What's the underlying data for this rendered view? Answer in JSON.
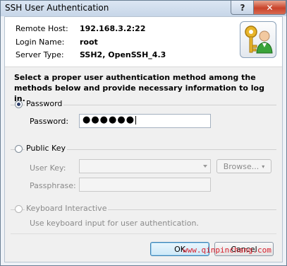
{
  "window": {
    "title": "SSH User Authentication",
    "help_label": "?",
    "close_label": "✕"
  },
  "info": {
    "remote_host_label": "Remote Host:",
    "remote_host_value": "192.168.3.2:22",
    "login_name_label": "Login Name:",
    "login_name_value": "root",
    "server_type_label": "Server Type:",
    "server_type_value": "SSH2, OpenSSH_4.3"
  },
  "instructions": "Select a proper user authentication method among the methods below and provide necessary information to log in.",
  "password_method": {
    "label": "Password",
    "selected": true,
    "field_label": "Password:",
    "masked_value": "●●●●●●"
  },
  "public_key_method": {
    "label": "Public Key",
    "selected": false,
    "user_key_label": "User Key:",
    "browse_label": "Browse...",
    "passphrase_label": "Passphrase:"
  },
  "keyboard_method": {
    "label": "Keyboard Interactive",
    "enabled": false,
    "description": "Use keyboard input for user authentication."
  },
  "buttons": {
    "ok": "OK",
    "cancel": "Cancel"
  },
  "watermark": "www.qinpinchang.com",
  "colors": {
    "accent": "#3c7fb1",
    "close_red": "#c9432a",
    "watermark_red": "#d9202c"
  }
}
